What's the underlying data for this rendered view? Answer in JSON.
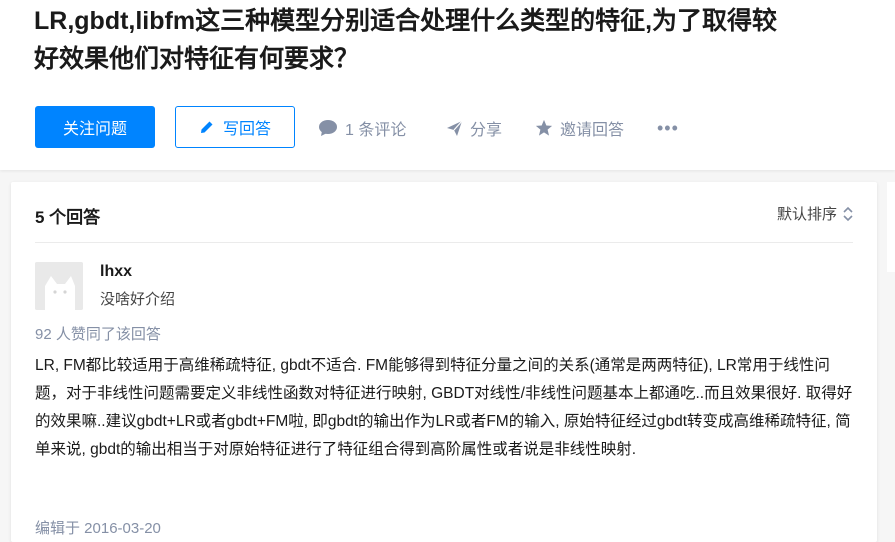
{
  "question": {
    "title_line1": "LR,gbdt,libfm这三种模型分别适合处理什么类型的特征,为了取得较",
    "title_line2": "好效果他们对特征有何要求？"
  },
  "actions": {
    "follow_label": "关注问题",
    "write_label": "写回答",
    "comment_label": "1 条评论",
    "share_label": "分享",
    "invite_label": "邀请回答",
    "more_label": "•••"
  },
  "answers": {
    "count_label": "5 个回答",
    "sort_label": "默认排序",
    "items": [
      {
        "author_name": "lhxx",
        "author_bio": "没啥好介绍",
        "votes_label": "92 人赞同了该回答",
        "content": "LR, FM都比较适用于高维稀疏特征, gbdt不适合. FM能够得到特征分量之间的关系(通常是两两特征), LR常用于线性问题，对于非线性问题需要定义非线性函数对特征进行映射, GBDT对线性/非线性问题基本上都通吃..而且效果很好. 取得好的效果嘛..建议gbdt+LR或者gbdt+FM啦, 即gbdt的输出作为LR或者FM的输入, 原始特征经过gbdt转变成高维稀疏特征, 简单来说, gbdt的输出相当于对原始特征进行了特征组合得到高阶属性或者说是非线性映射.",
        "edited_label": "编辑于 2016-03-20"
      }
    ]
  },
  "colors": {
    "brand": "#0084ff",
    "muted": "#8590a6",
    "text": "#1a1a1a",
    "page_bg": "#f6f6f6"
  },
  "icons": {
    "write": "pencil-icon",
    "comment": "comment-bubble-icon",
    "share": "paper-plane-icon",
    "invite": "star-icon",
    "sort": "up-down-chevron-icon"
  }
}
